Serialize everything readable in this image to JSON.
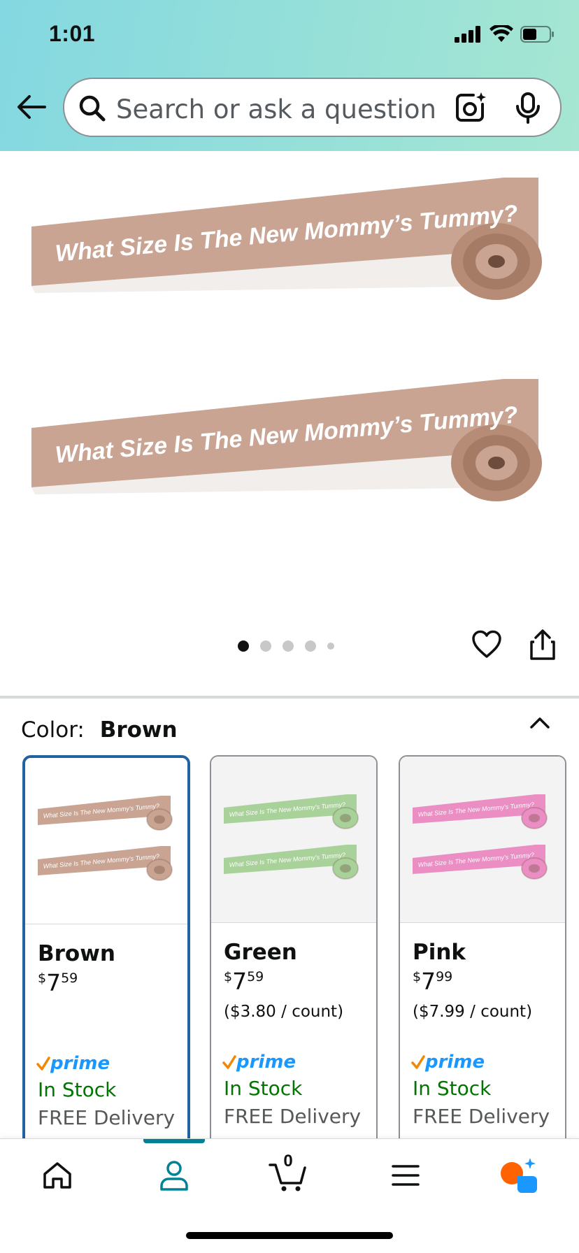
{
  "status_bar": {
    "time": "1:01"
  },
  "search": {
    "placeholder": "Search or ask a question"
  },
  "product_images": {
    "tape_text": "What Size Is The New Mommy’s Tummy?",
    "carousel_page_count": 5,
    "carousel_active_index": 0
  },
  "color_selector": {
    "label": "Color:",
    "selected": "Brown",
    "options": [
      {
        "name": "Brown",
        "currency": "$",
        "whole": "7",
        "fraction": "59",
        "unit_price": "",
        "prime": "prime",
        "stock": "In Stock",
        "delivery": "FREE Delivery",
        "tape_color": "#c9a493",
        "selected": true
      },
      {
        "name": "Green",
        "currency": "$",
        "whole": "7",
        "fraction": "59",
        "unit_price": "($3.80 / count)",
        "prime": "prime",
        "stock": "In Stock",
        "delivery": "FREE Delivery",
        "tape_color": "#a9d29b",
        "selected": false
      },
      {
        "name": "Pink",
        "currency": "$",
        "whole": "7",
        "fraction": "99",
        "unit_price": "($7.99 / count)",
        "prime": "prime",
        "stock": "In Stock",
        "delivery": "FREE Delivery",
        "tape_color": "#ea8ec3",
        "selected": false
      }
    ]
  },
  "bottom_nav": {
    "cart_count": "0",
    "active_tab": "account"
  },
  "colors": {
    "accent_blue": "#2162a1",
    "prime_blue": "#1a98ff",
    "prime_check": "#f08804",
    "in_stock_green": "#007600",
    "nav_teal": "#008296",
    "main_tape": "#c9a493"
  }
}
